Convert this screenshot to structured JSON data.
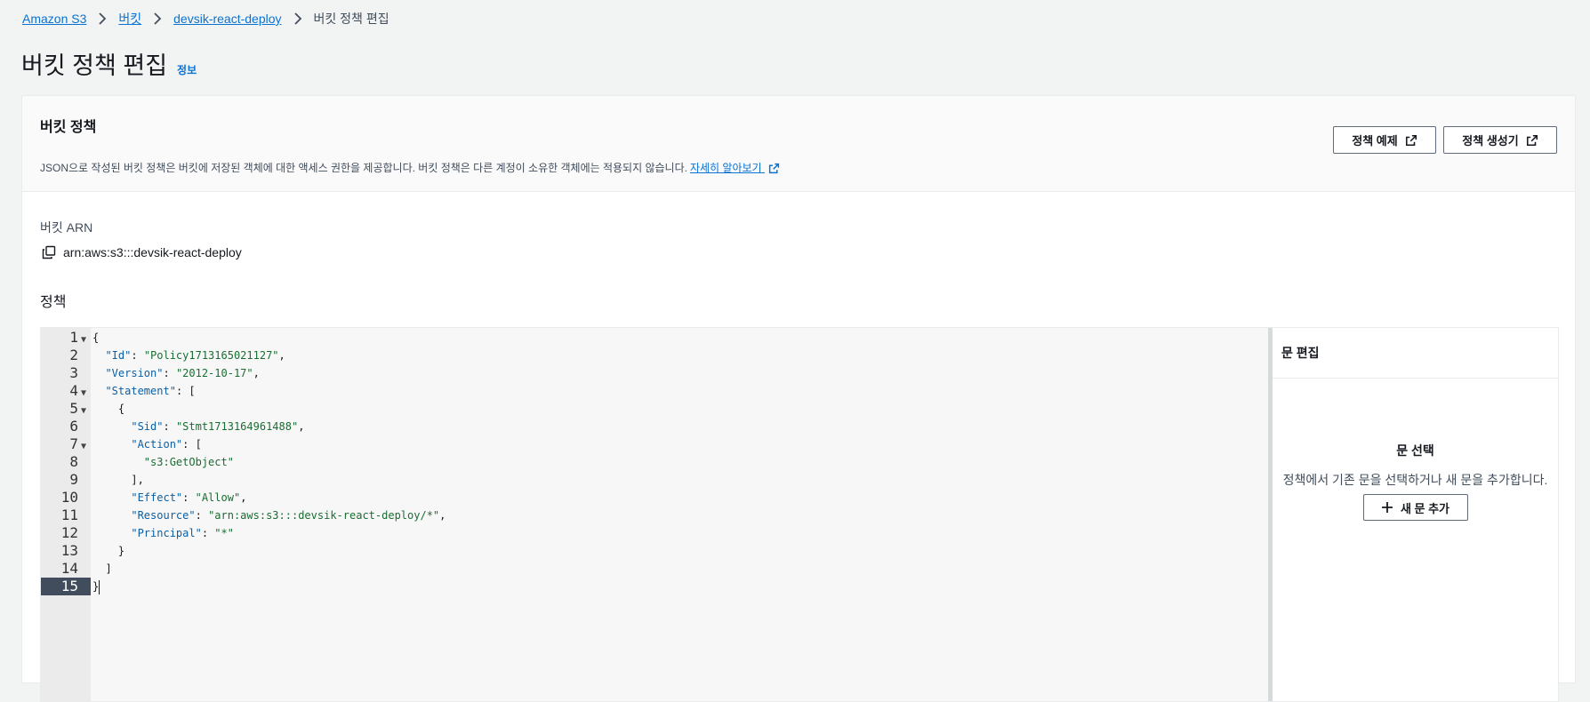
{
  "breadcrumb": {
    "items": [
      "Amazon S3",
      "버킷",
      "devsik-react-deploy"
    ],
    "current": "버킷 정책 편집"
  },
  "page": {
    "title": "버킷 정책 편집",
    "info": "정보"
  },
  "policy_section": {
    "heading": "버킷 정책",
    "description": "JSON으로 작성된 버킷 정책은 버킷에 저장된 객체에 대한 액세스 권한을 제공합니다. 버킷 정책은 다른 계정이 소유한 객체에는 적용되지 않습니다.",
    "learn_more": "자세히 알아보기",
    "examples_button": "정책 예제",
    "generator_button": "정책 생성기"
  },
  "arn": {
    "label": "버킷 ARN",
    "value": "arn:aws:s3:::devsik-react-deploy"
  },
  "editor": {
    "label": "정책",
    "active_line": 15,
    "lines": [
      "{",
      "  \"Id\": \"Policy1713165021127\",",
      "  \"Version\": \"2012-10-17\",",
      "  \"Statement\": [",
      "    {",
      "      \"Sid\": \"Stmt1713164961488\",",
      "      \"Action\": [",
      "        \"s3:GetObject\"",
      "      ],",
      "      \"Effect\": \"Allow\",",
      "      \"Resource\": \"arn:aws:s3:::devsik-react-deploy/*\",",
      "      \"Principal\": \"*\"",
      "    }",
      "  ]",
      "}"
    ],
    "fold_lines": [
      1,
      4,
      5,
      7
    ]
  },
  "statement_panel": {
    "heading": "문 편집",
    "select_title": "문 선택",
    "select_desc": "정책에서 기존 문을 선택하거나 새 문을 추가합니다.",
    "add_button": "새 문 추가"
  }
}
